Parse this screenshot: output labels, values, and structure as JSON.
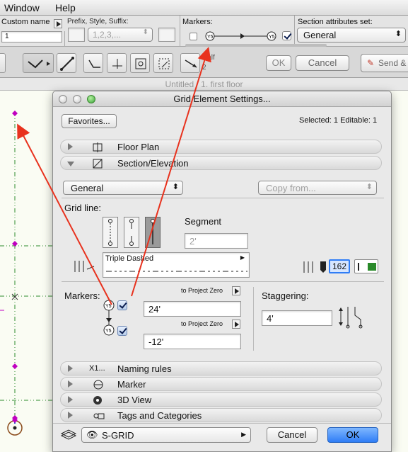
{
  "menu": {
    "window": "Window",
    "help": "Help"
  },
  "infobar": {
    "custom_name_label": "Custom name",
    "custom_name_value": "1",
    "prefix_label": "Prefix, Style, Suffix:",
    "style_value": "1,2,3,...",
    "markers_label": "Markers:",
    "section_attr_label": "Section attributes set:",
    "section_attr_value": "General"
  },
  "toolbar": {
    "half_label": "Half",
    "half_value": "2",
    "ok": "OK",
    "cancel": "Cancel",
    "send": "Send &"
  },
  "window_title": "Untitled / 1. first floor",
  "dialog": {
    "title": "Grid Element Settings...",
    "favorites": "Favorites...",
    "selected": "Selected: 1 Editable: 1",
    "sections": {
      "floor_plan": "Floor Plan",
      "section_elevation": "Section/Elevation",
      "naming_rules": "Naming rules",
      "naming_icon": "X1...",
      "marker": "Marker",
      "view3d": "3D View",
      "tags": "Tags and Categories"
    },
    "general_value": "General",
    "copy_from": "Copy from...",
    "grid_line_label": "Grid line:",
    "segment_label": "Segment",
    "segment_value": "2'",
    "linetype_name": "Triple Dashed",
    "pen_number": "162",
    "markers_label": "Markers:",
    "to_project_zero_1": "to Project Zero",
    "to_project_zero_2": "to Project Zero",
    "marker_value_1": "24'",
    "marker_value_2": "-12'",
    "staggering_label": "Staggering:",
    "staggering_value": "4'",
    "marker_symbol": "Y5",
    "layer": "S-GRID",
    "cancel": "Cancel",
    "ok": "OK"
  },
  "colors": {
    "arrow": "#e8321e",
    "accent": "#2f7df6",
    "grid_line": "#2e8b2e",
    "grid_point": "#c000c0",
    "pen": "#2a8a2a"
  }
}
